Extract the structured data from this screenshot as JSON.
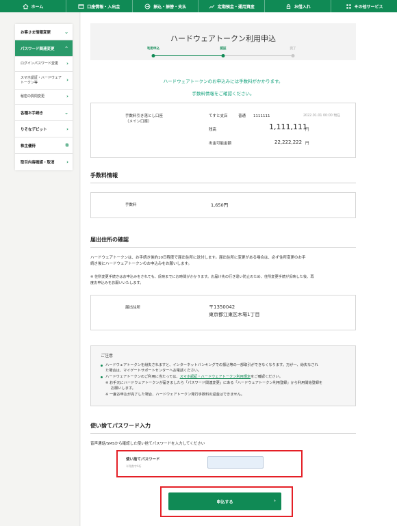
{
  "topnav": {
    "items": [
      {
        "label": "ホーム",
        "icon": "home-icon"
      },
      {
        "label": "口座情報・入出金",
        "icon": "account-icon"
      },
      {
        "label": "振込・振替・支払",
        "icon": "transfer-icon"
      },
      {
        "label": "定期預金・運用資産",
        "icon": "deposit-icon"
      },
      {
        "label": "お借入れ",
        "icon": "loan-icon"
      },
      {
        "label": "その他サービス",
        "icon": "grid-icon"
      }
    ]
  },
  "sidebar": {
    "customer_info": "お客さま情報変更",
    "password": "パスワード関連変更",
    "login_password": "ログインパスワード変更",
    "smartphone_token_line1": "スマホ認証・ハードウェア",
    "smartphone_token_line2": "トークン等",
    "secret_question": "秘密の質問変更",
    "procedures": "各種お手続き",
    "debit": "りそなデビット",
    "shareholder": "株主優待",
    "transactions": "取引内容確認・取消"
  },
  "page": {
    "title": "ハードウェアトークン利用申込",
    "steps": [
      "利用申込",
      "認証",
      "完了"
    ],
    "notice_line1": "ハードウェアトークンのお申込みには手数料がかかります。",
    "notice_line2": "手数料情報をご確認ください。"
  },
  "account": {
    "label_line1": "手数料引き落とし口座",
    "label_line2": "（メイン口座）",
    "branch": "てすと支店",
    "type": "普通",
    "number": "1111111",
    "timestamp": "2022.01.01 00:00 現在",
    "balance_label": "残高",
    "balance": "1,111,111",
    "balance_unit": "円",
    "withdrawable_label": "出金可能金額",
    "withdrawable": "22,222,222",
    "withdrawable_unit": "円"
  },
  "fee": {
    "heading": "手数料情報",
    "label": "手数料",
    "value": "1,650円"
  },
  "address": {
    "heading": "届出住所の確認",
    "para1_line1": "ハードウェアトークンは、お手続き後約10日程度で届出住所に送付します。届出住所に変更がある場合は、必ず住所変更のお手",
    "para1_line2": "続き後にハードウェアトークンのお申込みをお願いします。",
    "para2_line1": "※ 住所変更手続きはお申込みをされても、反映までにお時間がかかります。お届け先の行き違い防止のため、住所変更手続が反映した後、再",
    "para2_line2": "度お申込みをお願いいたします。",
    "label": "届出住所",
    "postal": "〒1350042",
    "street": "東京都江東区木場1丁目"
  },
  "caution": {
    "title": "ご注意",
    "b1_line1": "ハードウェアトークンを紛失されますと、インターネットバンキングでの振込等の一部取引ができなくなります。万が一、紛失なされ",
    "b1_line2": "た場合は、マイゲートサポートセンターへお電話ください。",
    "b2_pre": "ハードウェアトークンのご利用に当たっては、",
    "b2_link": "スマホ認証・ハードウェアトークン利用規定",
    "b2_post": "をご確認ください。",
    "n1_line1": "※ お手元にハードウェアトークンが届きましたら「パスワード関連変更」にある「ハードウェアトークン利用登録」から利用開始登録を",
    "n1_line2": "お願いします。",
    "n2": "※ 一度お申込が完了した場合、ハードウェアトークン発行手数料の返金はできません。"
  },
  "otp": {
    "heading": "使い捨てパスワード入力",
    "instruction": "音声通話/SMSから確認した使い捨てパスワードを入力してください",
    "label": "使い捨てパスワード",
    "hint": "半角数字6桁",
    "value": ""
  },
  "submit": {
    "label": "申込する",
    "arrow": "›"
  },
  "colors": {
    "brand_green": "#108a55",
    "notice_green": "#10a07a",
    "highlight_red": "#e41f26",
    "step_inactive": "#c8c8c8"
  }
}
